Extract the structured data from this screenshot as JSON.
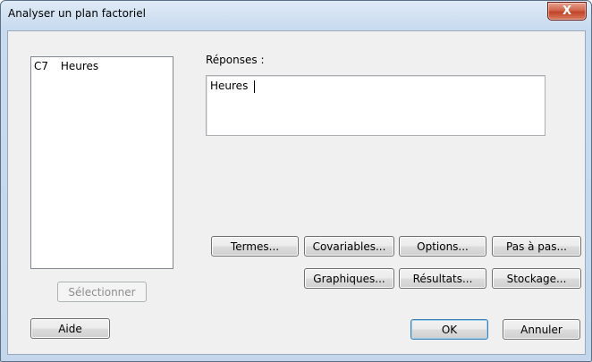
{
  "window": {
    "title": "Analyser un plan factoriel",
    "close_glyph": "X"
  },
  "variables": {
    "items": [
      {
        "column": "C7",
        "name": "Heures"
      }
    ]
  },
  "responses": {
    "label": "Réponses :",
    "value": "Heures"
  },
  "buttons": {
    "termes": "Termes...",
    "covariables": "Covariables...",
    "options": "Options...",
    "pas_a_pas": "Pas à pas...",
    "graphiques": "Graphiques...",
    "resultats": "Résultats...",
    "stockage": "Stockage...",
    "selectionner": "Sélectionner",
    "aide": "Aide",
    "ok": "OK",
    "annuler": "Annuler"
  }
}
